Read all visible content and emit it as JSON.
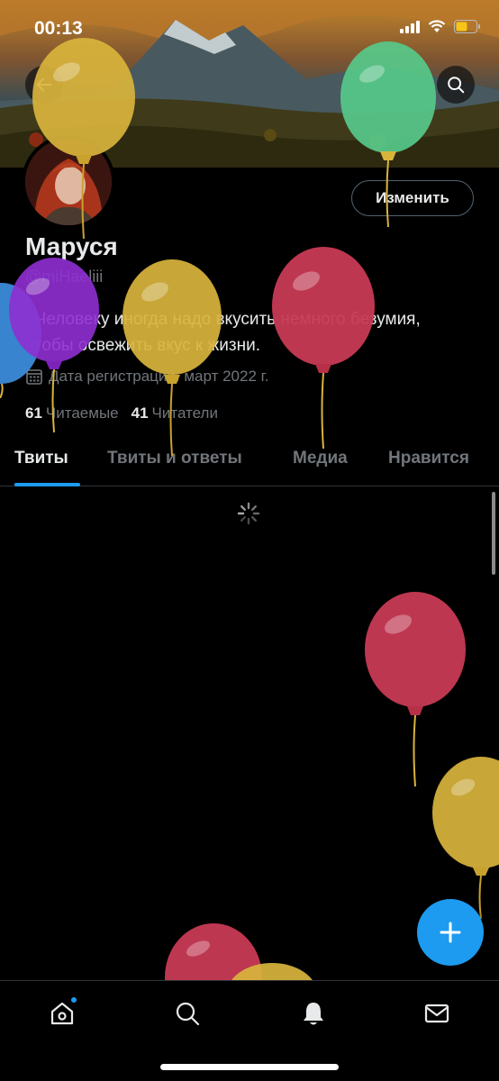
{
  "status_bar": {
    "time": "00:13"
  },
  "profile": {
    "name": "Маруся",
    "handle": "@miHaeliii",
    "bio": "«Человеку иногда надо вкусить немного безумия, чтобы освежить вкус к жизни.",
    "join_date": "Дата регистрации: март 2022 г.",
    "following_count": "61",
    "following_label": "Читаемые",
    "followers_count": "41",
    "followers_label": "Читатели",
    "edit_label": "Изменить"
  },
  "tabs": [
    {
      "label": "Твиты",
      "active": true
    },
    {
      "label": "Твиты и ответы",
      "active": false
    },
    {
      "label": "Медиа",
      "active": false
    },
    {
      "label": "Нравится",
      "active": false
    }
  ],
  "icons": {
    "header_back": "arrow-left-icon",
    "header_search": "search-icon",
    "join": "calendar-icon",
    "fab": "plus-icon",
    "nav": [
      "home-icon",
      "search-icon",
      "bell-icon",
      "mail-icon"
    ]
  },
  "colors": {
    "accent": "#1d9bf0",
    "background": "#000000",
    "text_primary": "#e7e9ea",
    "text_secondary": "#71767b",
    "balloon_yellow": "#d9b43c",
    "balloon_red": "#c83a55",
    "balloon_green": "#57c98a",
    "balloon_purple": "#8f2fd1",
    "balloon_blue": "#3d8fe0"
  }
}
